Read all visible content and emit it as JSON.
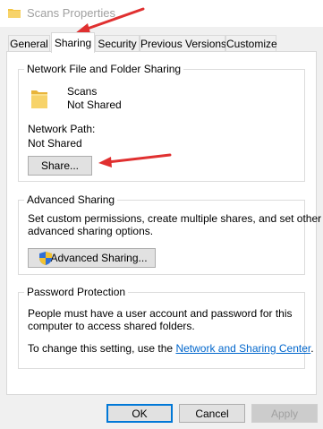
{
  "window": {
    "title": "Scans Properties"
  },
  "tabs": [
    {
      "label": "General"
    },
    {
      "label": "Sharing"
    },
    {
      "label": "Security"
    },
    {
      "label": "Previous Versions"
    },
    {
      "label": "Customize"
    }
  ],
  "network_sharing": {
    "title": "Network File and Folder Sharing",
    "folder_name": "Scans",
    "folder_status": "Not Shared",
    "path_label": "Network Path:",
    "path_value": "Not Shared",
    "share_button": "Share..."
  },
  "advanced_sharing": {
    "title": "Advanced Sharing",
    "description_line1": "Set custom permissions, create multiple shares, and set other",
    "description_line2": "advanced sharing options.",
    "button": "Advanced Sharing..."
  },
  "password_protection": {
    "title": "Password Protection",
    "text_line1": "People must have a user account and password for this",
    "text_line2": "computer to access shared folders.",
    "change_prefix": "To change this setting, use the",
    "link": "Network and Sharing Center",
    "change_suffix": "."
  },
  "footer": {
    "ok": "OK",
    "cancel": "Cancel",
    "apply": "Apply"
  },
  "colors": {
    "annotation_arrow": "#e03030",
    "folder": "#f4c542",
    "link": "#0066cc",
    "shield_blue": "#2f6fd6",
    "shield_yellow": "#f2c230"
  }
}
